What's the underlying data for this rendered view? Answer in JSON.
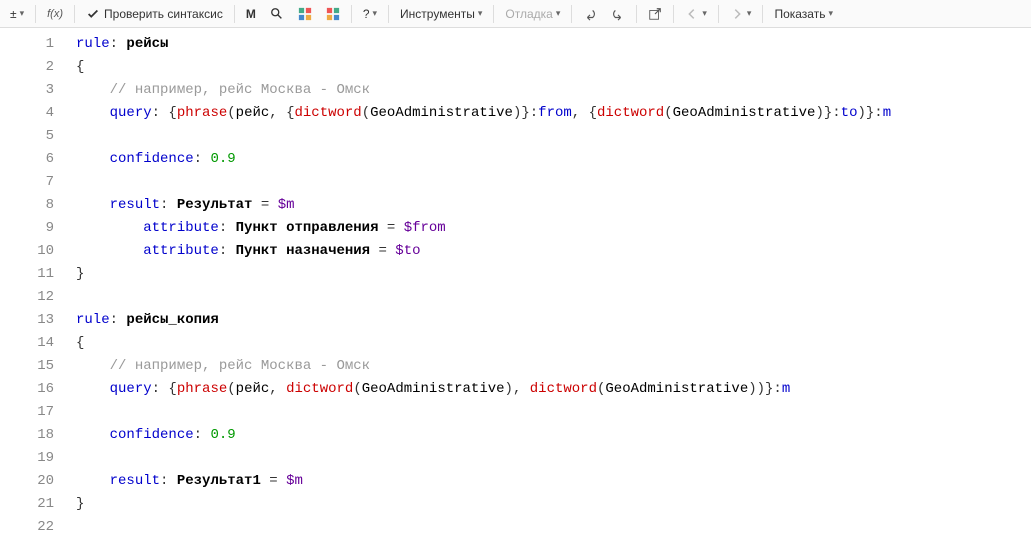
{
  "toolbar": {
    "plus_minus": "±",
    "fx": "f(x)",
    "check_syntax": "Проверить синтаксис",
    "m_icon": "M",
    "instruments": "Инструменты",
    "debug": "Отладка",
    "help": "?",
    "show": "Показать"
  },
  "code": {
    "lines": [
      {
        "n": 1,
        "segs": [
          {
            "t": "rule",
            "c": "kw"
          },
          {
            "t": ": ",
            "c": "punct"
          },
          {
            "t": "рейсы",
            "c": "name"
          }
        ]
      },
      {
        "n": 2,
        "segs": [
          {
            "t": "{",
            "c": "punct"
          }
        ]
      },
      {
        "n": 3,
        "segs": [
          {
            "t": "    ",
            "c": ""
          },
          {
            "t": "// например, рейс Москва - Омск",
            "c": "comment"
          }
        ]
      },
      {
        "n": 4,
        "segs": [
          {
            "t": "    ",
            "c": ""
          },
          {
            "t": "query",
            "c": "kw"
          },
          {
            "t": ": {",
            "c": "punct"
          },
          {
            "t": "phrase",
            "c": "func"
          },
          {
            "t": "(",
            "c": "punct"
          },
          {
            "t": "рейс",
            "c": "ident"
          },
          {
            "t": ", {",
            "c": "punct"
          },
          {
            "t": "dictword",
            "c": "func"
          },
          {
            "t": "(",
            "c": "punct"
          },
          {
            "t": "GeoAdministrative",
            "c": "ident"
          },
          {
            "t": ")}:",
            "c": "punct"
          },
          {
            "t": "from",
            "c": "kw"
          },
          {
            "t": ", {",
            "c": "punct"
          },
          {
            "t": "dictword",
            "c": "func"
          },
          {
            "t": "(",
            "c": "punct"
          },
          {
            "t": "GeoAdministrative",
            "c": "ident"
          },
          {
            "t": ")}:",
            "c": "punct"
          },
          {
            "t": "to",
            "c": "kw"
          },
          {
            "t": ")}:",
            "c": "punct"
          },
          {
            "t": "m",
            "c": "kw"
          }
        ]
      },
      {
        "n": 5,
        "segs": []
      },
      {
        "n": 6,
        "segs": [
          {
            "t": "    ",
            "c": ""
          },
          {
            "t": "confidence",
            "c": "kw"
          },
          {
            "t": ": ",
            "c": "punct"
          },
          {
            "t": "0.9",
            "c": "num"
          }
        ]
      },
      {
        "n": 7,
        "segs": []
      },
      {
        "n": 8,
        "segs": [
          {
            "t": "    ",
            "c": ""
          },
          {
            "t": "result",
            "c": "kw"
          },
          {
            "t": ": ",
            "c": "punct"
          },
          {
            "t": "Результат",
            "c": "name"
          },
          {
            "t": " = ",
            "c": "punct"
          },
          {
            "t": "$m",
            "c": "var"
          }
        ]
      },
      {
        "n": 9,
        "segs": [
          {
            "t": "        ",
            "c": ""
          },
          {
            "t": "attribute",
            "c": "kw"
          },
          {
            "t": ": ",
            "c": "punct"
          },
          {
            "t": "Пункт отправления",
            "c": "name"
          },
          {
            "t": " = ",
            "c": "punct"
          },
          {
            "t": "$from",
            "c": "var"
          }
        ]
      },
      {
        "n": 10,
        "segs": [
          {
            "t": "        ",
            "c": ""
          },
          {
            "t": "attribute",
            "c": "kw"
          },
          {
            "t": ": ",
            "c": "punct"
          },
          {
            "t": "Пункт назначения",
            "c": "name"
          },
          {
            "t": " = ",
            "c": "punct"
          },
          {
            "t": "$to",
            "c": "var"
          }
        ]
      },
      {
        "n": 11,
        "segs": [
          {
            "t": "}",
            "c": "punct"
          }
        ]
      },
      {
        "n": 12,
        "segs": []
      },
      {
        "n": 13,
        "segs": [
          {
            "t": "rule",
            "c": "kw"
          },
          {
            "t": ": ",
            "c": "punct"
          },
          {
            "t": "рейсы_копия",
            "c": "name"
          }
        ]
      },
      {
        "n": 14,
        "segs": [
          {
            "t": "{",
            "c": "punct"
          }
        ]
      },
      {
        "n": 15,
        "segs": [
          {
            "t": "    ",
            "c": ""
          },
          {
            "t": "// например, рейс Москва - Омск",
            "c": "comment"
          }
        ]
      },
      {
        "n": 16,
        "segs": [
          {
            "t": "    ",
            "c": ""
          },
          {
            "t": "query",
            "c": "kw"
          },
          {
            "t": ": {",
            "c": "punct"
          },
          {
            "t": "phrase",
            "c": "func"
          },
          {
            "t": "(",
            "c": "punct"
          },
          {
            "t": "рейс",
            "c": "ident"
          },
          {
            "t": ", ",
            "c": "punct"
          },
          {
            "t": "dictword",
            "c": "func"
          },
          {
            "t": "(",
            "c": "punct"
          },
          {
            "t": "GeoAdministrative",
            "c": "ident"
          },
          {
            "t": "), ",
            "c": "punct"
          },
          {
            "t": "dictword",
            "c": "func"
          },
          {
            "t": "(",
            "c": "punct"
          },
          {
            "t": "GeoAdministrative",
            "c": "ident"
          },
          {
            "t": "))}:",
            "c": "punct"
          },
          {
            "t": "m",
            "c": "kw"
          }
        ]
      },
      {
        "n": 17,
        "segs": []
      },
      {
        "n": 18,
        "segs": [
          {
            "t": "    ",
            "c": ""
          },
          {
            "t": "confidence",
            "c": "kw"
          },
          {
            "t": ": ",
            "c": "punct"
          },
          {
            "t": "0.9",
            "c": "num"
          }
        ]
      },
      {
        "n": 19,
        "segs": []
      },
      {
        "n": 20,
        "segs": [
          {
            "t": "    ",
            "c": ""
          },
          {
            "t": "result",
            "c": "kw"
          },
          {
            "t": ": ",
            "c": "punct"
          },
          {
            "t": "Результат1",
            "c": "name"
          },
          {
            "t": " = ",
            "c": "punct"
          },
          {
            "t": "$m",
            "c": "var"
          }
        ]
      },
      {
        "n": 21,
        "segs": [
          {
            "t": "}",
            "c": "punct"
          }
        ]
      },
      {
        "n": 22,
        "segs": []
      }
    ]
  }
}
